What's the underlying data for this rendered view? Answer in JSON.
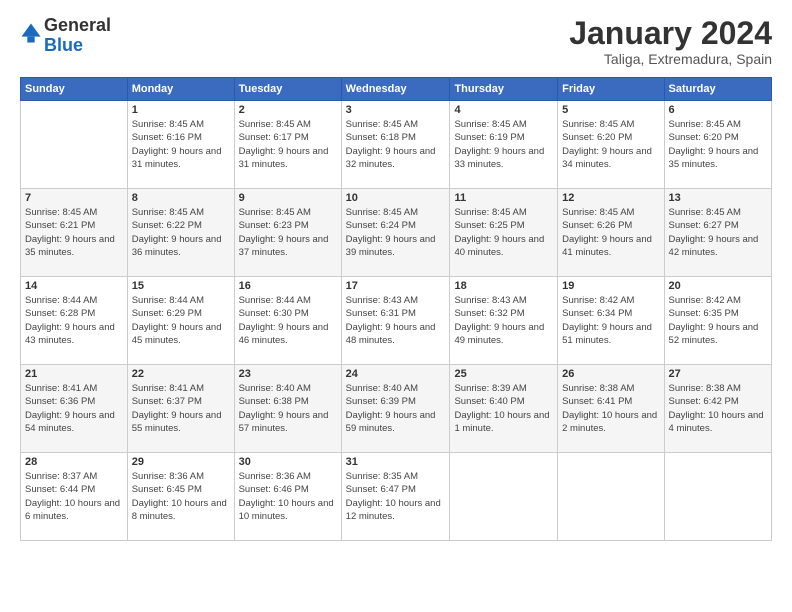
{
  "logo": {
    "text_general": "General",
    "text_blue": "Blue"
  },
  "header": {
    "title": "January 2024",
    "subtitle": "Taliga, Extremadura, Spain"
  },
  "calendar": {
    "columns": [
      "Sunday",
      "Monday",
      "Tuesday",
      "Wednesday",
      "Thursday",
      "Friday",
      "Saturday"
    ],
    "rows": [
      [
        {
          "day": "",
          "sunrise": "",
          "sunset": "",
          "daylight": ""
        },
        {
          "day": "1",
          "sunrise": "Sunrise: 8:45 AM",
          "sunset": "Sunset: 6:16 PM",
          "daylight": "Daylight: 9 hours and 31 minutes."
        },
        {
          "day": "2",
          "sunrise": "Sunrise: 8:45 AM",
          "sunset": "Sunset: 6:17 PM",
          "daylight": "Daylight: 9 hours and 31 minutes."
        },
        {
          "day": "3",
          "sunrise": "Sunrise: 8:45 AM",
          "sunset": "Sunset: 6:18 PM",
          "daylight": "Daylight: 9 hours and 32 minutes."
        },
        {
          "day": "4",
          "sunrise": "Sunrise: 8:45 AM",
          "sunset": "Sunset: 6:19 PM",
          "daylight": "Daylight: 9 hours and 33 minutes."
        },
        {
          "day": "5",
          "sunrise": "Sunrise: 8:45 AM",
          "sunset": "Sunset: 6:20 PM",
          "daylight": "Daylight: 9 hours and 34 minutes."
        },
        {
          "day": "6",
          "sunrise": "Sunrise: 8:45 AM",
          "sunset": "Sunset: 6:20 PM",
          "daylight": "Daylight: 9 hours and 35 minutes."
        }
      ],
      [
        {
          "day": "7",
          "sunrise": "Sunrise: 8:45 AM",
          "sunset": "Sunset: 6:21 PM",
          "daylight": "Daylight: 9 hours and 35 minutes."
        },
        {
          "day": "8",
          "sunrise": "Sunrise: 8:45 AM",
          "sunset": "Sunset: 6:22 PM",
          "daylight": "Daylight: 9 hours and 36 minutes."
        },
        {
          "day": "9",
          "sunrise": "Sunrise: 8:45 AM",
          "sunset": "Sunset: 6:23 PM",
          "daylight": "Daylight: 9 hours and 37 minutes."
        },
        {
          "day": "10",
          "sunrise": "Sunrise: 8:45 AM",
          "sunset": "Sunset: 6:24 PM",
          "daylight": "Daylight: 9 hours and 39 minutes."
        },
        {
          "day": "11",
          "sunrise": "Sunrise: 8:45 AM",
          "sunset": "Sunset: 6:25 PM",
          "daylight": "Daylight: 9 hours and 40 minutes."
        },
        {
          "day": "12",
          "sunrise": "Sunrise: 8:45 AM",
          "sunset": "Sunset: 6:26 PM",
          "daylight": "Daylight: 9 hours and 41 minutes."
        },
        {
          "day": "13",
          "sunrise": "Sunrise: 8:45 AM",
          "sunset": "Sunset: 6:27 PM",
          "daylight": "Daylight: 9 hours and 42 minutes."
        }
      ],
      [
        {
          "day": "14",
          "sunrise": "Sunrise: 8:44 AM",
          "sunset": "Sunset: 6:28 PM",
          "daylight": "Daylight: 9 hours and 43 minutes."
        },
        {
          "day": "15",
          "sunrise": "Sunrise: 8:44 AM",
          "sunset": "Sunset: 6:29 PM",
          "daylight": "Daylight: 9 hours and 45 minutes."
        },
        {
          "day": "16",
          "sunrise": "Sunrise: 8:44 AM",
          "sunset": "Sunset: 6:30 PM",
          "daylight": "Daylight: 9 hours and 46 minutes."
        },
        {
          "day": "17",
          "sunrise": "Sunrise: 8:43 AM",
          "sunset": "Sunset: 6:31 PM",
          "daylight": "Daylight: 9 hours and 48 minutes."
        },
        {
          "day": "18",
          "sunrise": "Sunrise: 8:43 AM",
          "sunset": "Sunset: 6:32 PM",
          "daylight": "Daylight: 9 hours and 49 minutes."
        },
        {
          "day": "19",
          "sunrise": "Sunrise: 8:42 AM",
          "sunset": "Sunset: 6:34 PM",
          "daylight": "Daylight: 9 hours and 51 minutes."
        },
        {
          "day": "20",
          "sunrise": "Sunrise: 8:42 AM",
          "sunset": "Sunset: 6:35 PM",
          "daylight": "Daylight: 9 hours and 52 minutes."
        }
      ],
      [
        {
          "day": "21",
          "sunrise": "Sunrise: 8:41 AM",
          "sunset": "Sunset: 6:36 PM",
          "daylight": "Daylight: 9 hours and 54 minutes."
        },
        {
          "day": "22",
          "sunrise": "Sunrise: 8:41 AM",
          "sunset": "Sunset: 6:37 PM",
          "daylight": "Daylight: 9 hours and 55 minutes."
        },
        {
          "day": "23",
          "sunrise": "Sunrise: 8:40 AM",
          "sunset": "Sunset: 6:38 PM",
          "daylight": "Daylight: 9 hours and 57 minutes."
        },
        {
          "day": "24",
          "sunrise": "Sunrise: 8:40 AM",
          "sunset": "Sunset: 6:39 PM",
          "daylight": "Daylight: 9 hours and 59 minutes."
        },
        {
          "day": "25",
          "sunrise": "Sunrise: 8:39 AM",
          "sunset": "Sunset: 6:40 PM",
          "daylight": "Daylight: 10 hours and 1 minute."
        },
        {
          "day": "26",
          "sunrise": "Sunrise: 8:38 AM",
          "sunset": "Sunset: 6:41 PM",
          "daylight": "Daylight: 10 hours and 2 minutes."
        },
        {
          "day": "27",
          "sunrise": "Sunrise: 8:38 AM",
          "sunset": "Sunset: 6:42 PM",
          "daylight": "Daylight: 10 hours and 4 minutes."
        }
      ],
      [
        {
          "day": "28",
          "sunrise": "Sunrise: 8:37 AM",
          "sunset": "Sunset: 6:44 PM",
          "daylight": "Daylight: 10 hours and 6 minutes."
        },
        {
          "day": "29",
          "sunrise": "Sunrise: 8:36 AM",
          "sunset": "Sunset: 6:45 PM",
          "daylight": "Daylight: 10 hours and 8 minutes."
        },
        {
          "day": "30",
          "sunrise": "Sunrise: 8:36 AM",
          "sunset": "Sunset: 6:46 PM",
          "daylight": "Daylight: 10 hours and 10 minutes."
        },
        {
          "day": "31",
          "sunrise": "Sunrise: 8:35 AM",
          "sunset": "Sunset: 6:47 PM",
          "daylight": "Daylight: 10 hours and 12 minutes."
        },
        {
          "day": "",
          "sunrise": "",
          "sunset": "",
          "daylight": ""
        },
        {
          "day": "",
          "sunrise": "",
          "sunset": "",
          "daylight": ""
        },
        {
          "day": "",
          "sunrise": "",
          "sunset": "",
          "daylight": ""
        }
      ]
    ]
  }
}
